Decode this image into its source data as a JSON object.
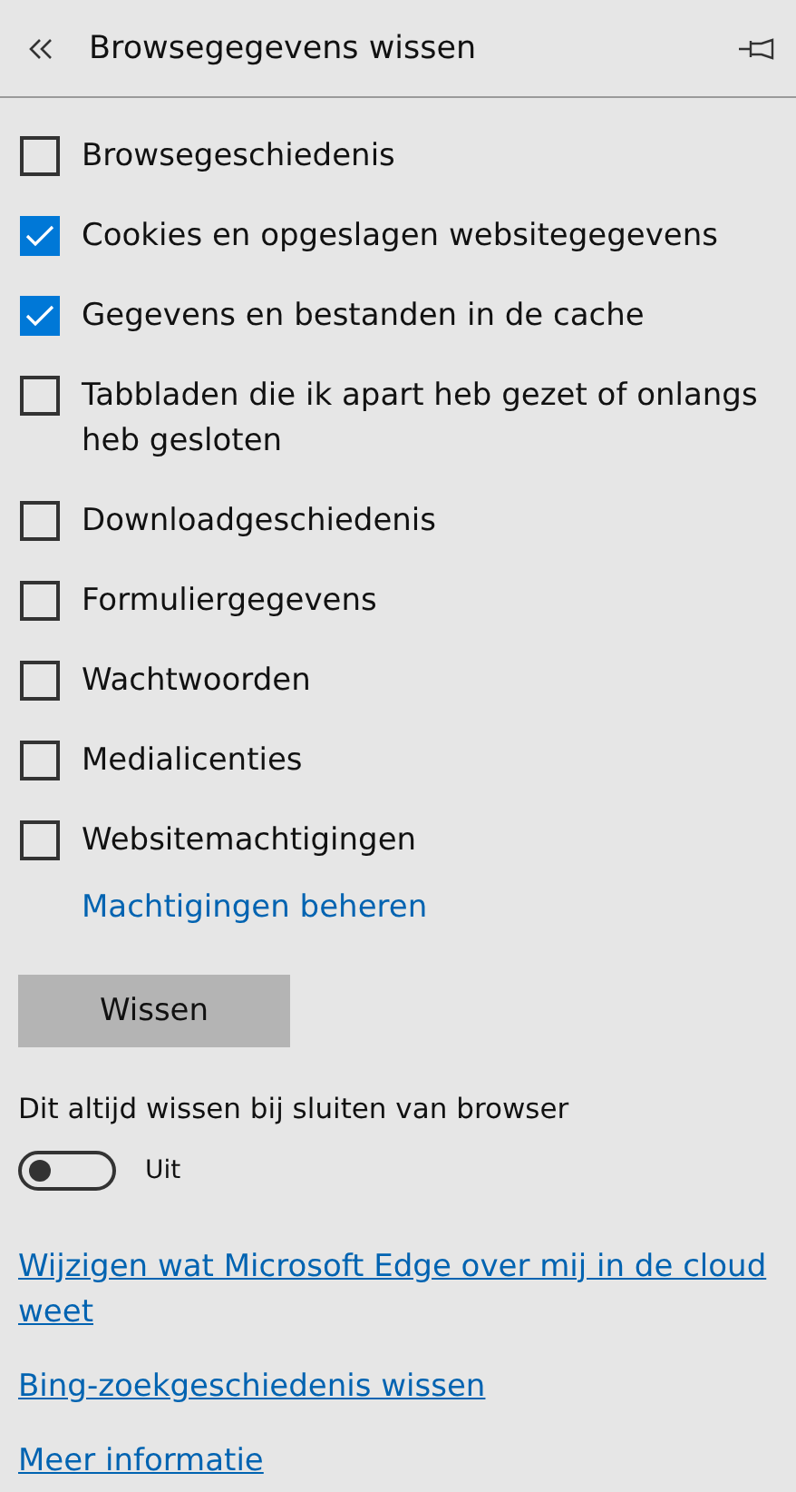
{
  "panel": {
    "title": "Browsegegevens wissen"
  },
  "options": [
    {
      "label": "Browsegeschiedenis",
      "checked": false
    },
    {
      "label": "Cookies en opgeslagen websitegegevens",
      "checked": true
    },
    {
      "label": "Gegevens en bestanden in de cache",
      "checked": true
    },
    {
      "label": "Tabbladen die ik apart heb gezet of onlangs heb gesloten",
      "checked": false
    },
    {
      "label": "Downloadgeschiedenis",
      "checked": false
    },
    {
      "label": "Formuliergegevens",
      "checked": false
    },
    {
      "label": "Wachtwoorden",
      "checked": false
    },
    {
      "label": "Medialicenties",
      "checked": false
    },
    {
      "label": "Websitemachtigingen",
      "checked": false
    }
  ],
  "manage_link": "Machtigingen beheren",
  "clear_button": "Wissen",
  "auto_clear": {
    "label": "Dit altijd wissen bij sluiten van browser",
    "on": false,
    "state_text": "Uit"
  },
  "links": [
    "Wijzigen wat Microsoft Edge over mij in de cloud weet",
    "Bing-zoekgeschiedenis wissen",
    "Meer informatie"
  ]
}
